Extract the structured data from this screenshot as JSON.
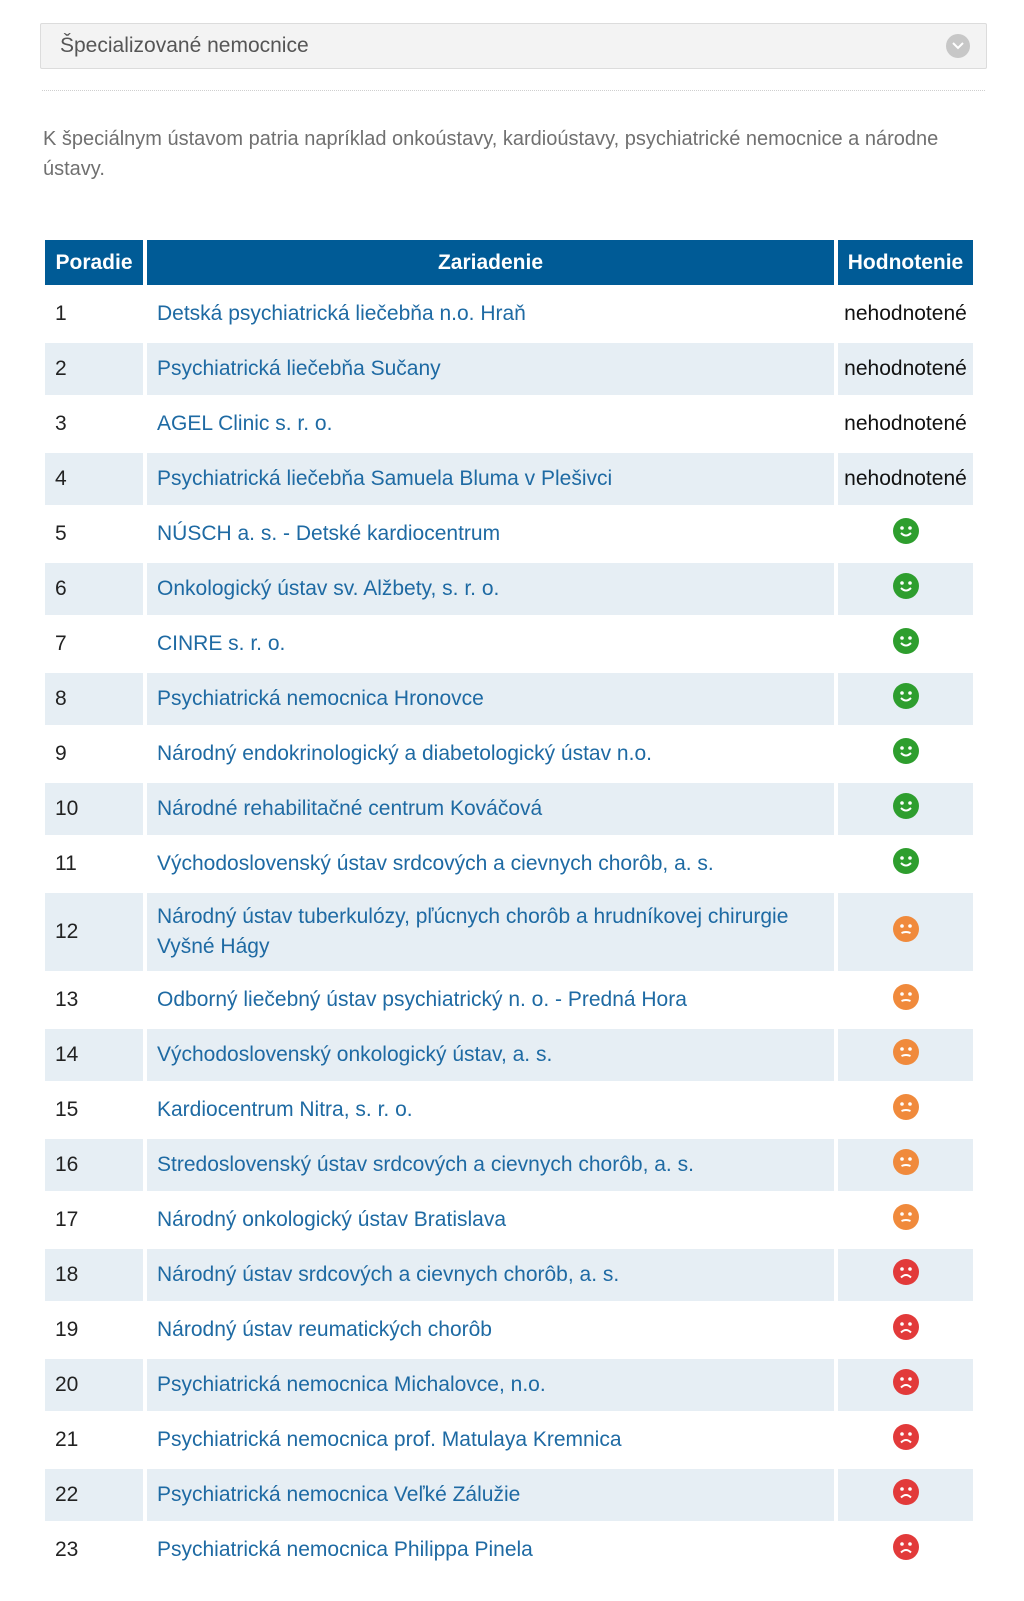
{
  "select": {
    "value": "Špecializované nemocnice",
    "chevron_icon": "chevron-down-icon"
  },
  "intro_text": "K špeciálnym ústavom patria napríklad onkoústavy, kardioústavy, psychiatrické nemocnice a národne ústavy.",
  "table": {
    "headers": {
      "rank": "Poradie",
      "facility": "Zariadenie",
      "rating": "Hodnotenie"
    },
    "rating_colors": {
      "good": "#2e9e2e",
      "neutral": "#f08a3c",
      "bad": "#e23a3a"
    },
    "rows": [
      {
        "rank": "1",
        "name": "Detská psychiatrická liečebňa n.o. Hraň",
        "rating_text": "nehodnotené",
        "rating": "none"
      },
      {
        "rank": "2",
        "name": "Psychiatrická liečebňa Sučany",
        "rating_text": "nehodnotené",
        "rating": "none"
      },
      {
        "rank": "3",
        "name": "AGEL Clinic s. r. o.",
        "rating_text": "nehodnotené",
        "rating": "none"
      },
      {
        "rank": "4",
        "name": "Psychiatrická liečebňa Samuela Bluma v Plešivci",
        "rating_text": "nehodnotené",
        "rating": "none"
      },
      {
        "rank": "5",
        "name": "NÚSCH a. s. - Detské kardiocentrum",
        "rating_text": "",
        "rating": "good"
      },
      {
        "rank": "6",
        "name": "Onkologický ústav sv. Alžbety, s. r. o.",
        "rating_text": "",
        "rating": "good"
      },
      {
        "rank": "7",
        "name": "CINRE s. r. o.",
        "rating_text": "",
        "rating": "good"
      },
      {
        "rank": "8",
        "name": "Psychiatrická nemocnica Hronovce",
        "rating_text": "",
        "rating": "good"
      },
      {
        "rank": "9",
        "name": "Národný endokrinologický a diabetologický ústav n.o.",
        "rating_text": "",
        "rating": "good"
      },
      {
        "rank": "10",
        "name": "Národné rehabilitačné centrum Kováčová",
        "rating_text": "",
        "rating": "good"
      },
      {
        "rank": "11",
        "name": "Východoslovenský ústav srdcových a cievnych chorôb, a. s.",
        "rating_text": "",
        "rating": "good"
      },
      {
        "rank": "12",
        "name": "Národný ústav tuberkulózy, pľúcnych chorôb a hrudníkovej chirurgie Vyšné Hágy",
        "rating_text": "",
        "rating": "neutral"
      },
      {
        "rank": "13",
        "name": "Odborný liečebný ústav psychiatrický n. o. - Predná Hora",
        "rating_text": "",
        "rating": "neutral"
      },
      {
        "rank": "14",
        "name": "Východoslovenský onkologický ústav, a. s.",
        "rating_text": "",
        "rating": "neutral"
      },
      {
        "rank": "15",
        "name": "Kardiocentrum Nitra, s. r. o.",
        "rating_text": "",
        "rating": "neutral"
      },
      {
        "rank": "16",
        "name": "Stredoslovenský ústav srdcových a cievnych chorôb, a. s.",
        "rating_text": "",
        "rating": "neutral"
      },
      {
        "rank": "17",
        "name": "Národný onkologický ústav Bratislava",
        "rating_text": "",
        "rating": "neutral"
      },
      {
        "rank": "18",
        "name": "Národný ústav srdcových a cievnych chorôb, a. s.",
        "rating_text": "",
        "rating": "bad"
      },
      {
        "rank": "19",
        "name": "Národný ústav reumatických chorôb",
        "rating_text": "",
        "rating": "bad"
      },
      {
        "rank": "20",
        "name": "Psychiatrická nemocnica Michalovce, n.o.",
        "rating_text": "",
        "rating": "bad"
      },
      {
        "rank": "21",
        "name": "Psychiatrická nemocnica prof. Matulaya Kremnica",
        "rating_text": "",
        "rating": "bad"
      },
      {
        "rank": "22",
        "name": "Psychiatrická nemocnica Veľké Zálužie",
        "rating_text": "",
        "rating": "bad"
      },
      {
        "rank": "23",
        "name": "Psychiatrická nemocnica Philippa Pinela",
        "rating_text": "",
        "rating": "bad"
      }
    ]
  }
}
